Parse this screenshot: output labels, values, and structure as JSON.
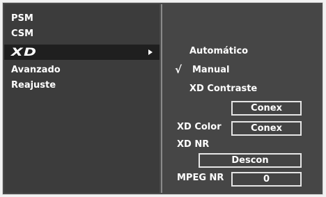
{
  "left_menu": {
    "items": [
      {
        "label": "PSM"
      },
      {
        "label": "CSM"
      },
      {
        "label": "XD"
      },
      {
        "label": "Avanzado"
      },
      {
        "label": "Reajuste"
      }
    ],
    "selected": "XD"
  },
  "xd_submenu": {
    "options": [
      {
        "label": "Automático"
      },
      {
        "label": "Manual",
        "checked": true
      },
      {
        "label": "XD Contraste"
      }
    ],
    "check_mark": "√",
    "xd_contrast_value": "Conex",
    "xd_color_label": "XD Color",
    "xd_color_value": "Conex",
    "xd_nr_label": "XD NR",
    "xd_nr_value": "Descon",
    "mpeg_nr_label": "MPEG NR",
    "mpeg_nr_value": "0"
  }
}
